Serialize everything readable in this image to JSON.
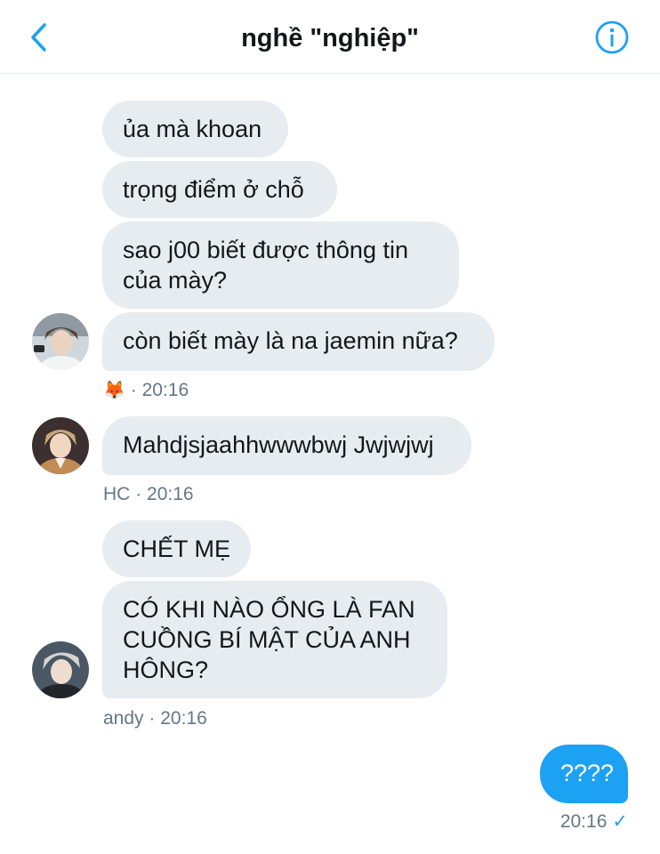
{
  "header": {
    "title": "nghề \"nghiệp\""
  },
  "messages": [
    {
      "text": "ủa mà khoan"
    },
    {
      "text": "trọng điểm ở chỗ"
    },
    {
      "line1": "sao j00 biết được thông tin",
      "line2": "của mày?"
    },
    {
      "text": "còn biết mày là na jaemin nữa?"
    },
    {
      "text": "Mahdjsjaahhwwwbwj Jwjwjwj"
    },
    {
      "text": "CHẾT MẸ"
    },
    {
      "line1": "CÓ KHI NÀO ỔNG LÀ FAN",
      "line2": "CUỒNG BÍ MẬT CỦA ANH",
      "line3": "HÔNG?"
    },
    {
      "text": "????"
    }
  ],
  "groups": [
    {
      "sender_emoji": "🦊",
      "separator": "·",
      "time": "20:16"
    },
    {
      "sender": "HC",
      "separator": "·",
      "time": "20:16"
    },
    {
      "sender": "andy",
      "separator": "·",
      "time": "20:16"
    }
  ],
  "own": {
    "time": "20:16",
    "status_icon": "✓"
  },
  "colors": {
    "accent": "#1da1f2",
    "incoming_bubble": "#e6ecf0",
    "meta_text": "#657786"
  },
  "icons": {
    "back": "chevron-left-icon",
    "info": "info-circle-icon"
  }
}
